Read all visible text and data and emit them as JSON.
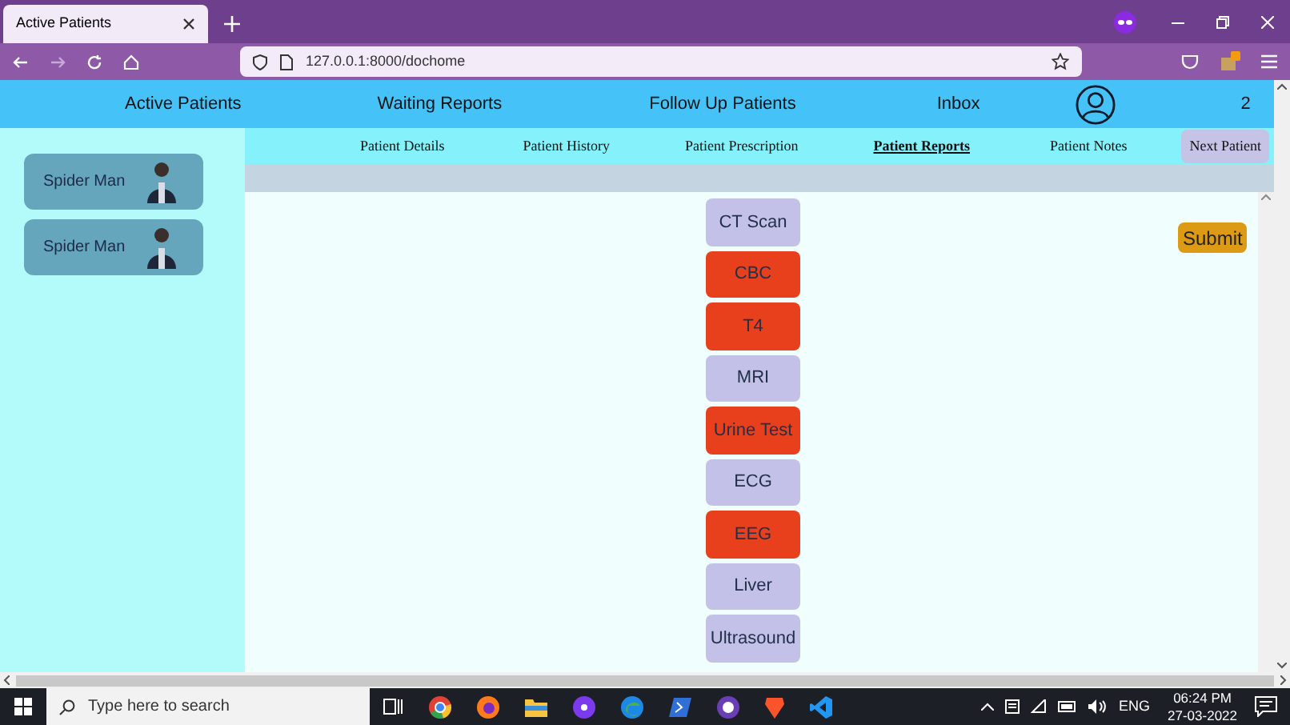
{
  "browser": {
    "tab_title": "Active Patients",
    "url": "127.0.0.1:8000/dochome"
  },
  "nav": {
    "items": [
      "Active Patients",
      "Waiting Reports",
      "Follow Up Patients",
      "Inbox"
    ],
    "count": "2"
  },
  "patients": [
    {
      "name": "Spider Man"
    },
    {
      "name": "Spider Man"
    }
  ],
  "tabs": [
    {
      "label": "Patient Details",
      "selected": false
    },
    {
      "label": "Patient History",
      "selected": false
    },
    {
      "label": "Patient Prescription",
      "selected": false
    },
    {
      "label": "Patient Reports",
      "selected": true
    },
    {
      "label": "Patient Notes",
      "selected": false
    }
  ],
  "next_button": "Next Patient",
  "reports": [
    {
      "label": "CT Scan",
      "selected": false
    },
    {
      "label": "CBC",
      "selected": true
    },
    {
      "label": "T4",
      "selected": true
    },
    {
      "label": "MRI",
      "selected": false
    },
    {
      "label": "Urine Test",
      "selected": true
    },
    {
      "label": "ECG",
      "selected": false
    },
    {
      "label": "EEG",
      "selected": true
    },
    {
      "label": "Liver",
      "selected": false
    },
    {
      "label": "Ultrasound",
      "selected": false
    }
  ],
  "submit_button": "Submit",
  "taskbar": {
    "search_placeholder": "Type here to search",
    "language": "ENG",
    "time": "06:24 PM",
    "date": "27-03-2022"
  }
}
